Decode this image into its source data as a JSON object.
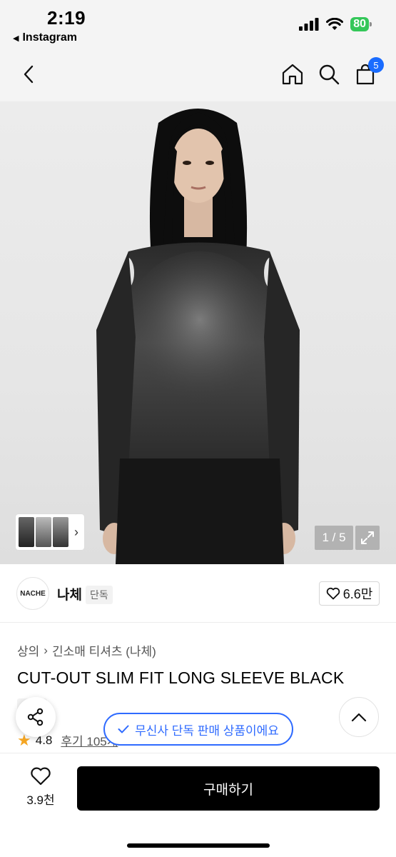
{
  "status_bar": {
    "time": "2:19",
    "back_app": "Instagram",
    "battery": "80"
  },
  "header": {
    "cart_count": "5"
  },
  "gallery": {
    "page_counter": "1 / 5"
  },
  "brand": {
    "logo_text": "NACHE",
    "name": "나체",
    "tag": "단독",
    "likes": "6.6만"
  },
  "product": {
    "breadcrumb": [
      "상의",
      "긴소매 티셔츠 (나체)"
    ],
    "title": "CUT-OUT SLIM FIT LONG SLEEVE BLACK",
    "exclusive_tag": "단독",
    "rating": "4.8",
    "review_label": "후기 105개"
  },
  "toast": {
    "text": "무신사 단독 판매 상품이에요"
  },
  "bottom_bar": {
    "wish_count": "3.9천",
    "buy_label": "구매하기"
  },
  "colors": {
    "accent_blue": "#2f6bff",
    "badge_blue": "#1a6cff",
    "star": "#f5a623",
    "battery": "#34c759"
  }
}
